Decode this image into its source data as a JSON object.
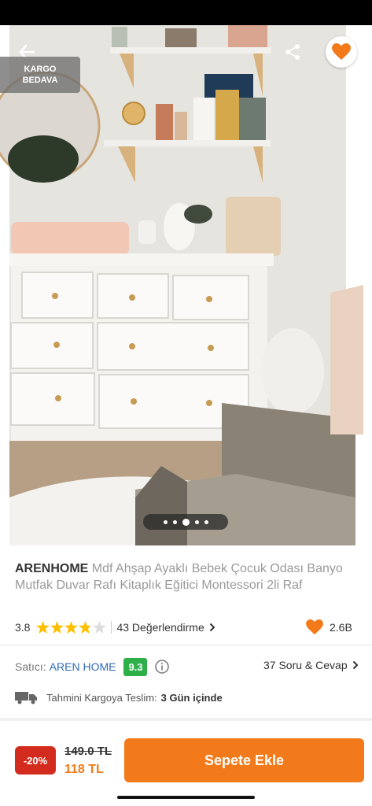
{
  "product": {
    "brand": "ARENHOME",
    "name": "Mdf Ahşap Ayaklı Bebek Çocuk Odası Banyo Mutfak Duvar Rafı Kitaplık Eğitici Montessori 2li Raf"
  },
  "image": {
    "badge_line1": "KARGO",
    "badge_line2": "BEDAVA",
    "carousel_total": 5,
    "carousel_active": 3
  },
  "rating": {
    "score": "3.8",
    "stars": 3.8,
    "reviews": "43 Değerlendirme",
    "likes": "2.6B"
  },
  "seller": {
    "label": "Satıcı:",
    "name": "AREN HOME",
    "score": "9.3",
    "qa": "37 Soru & Cevap"
  },
  "delivery": {
    "label": "Tahmini Kargoya Teslim:",
    "days": "3 Gün içinde"
  },
  "pricing": {
    "discount": "-20%",
    "old_price": "149.0 TL",
    "new_price": "118 TL",
    "cart_button": "Sepete Ekle"
  },
  "icons": {
    "back": "back-arrow-icon",
    "share": "share-icon",
    "favorite": "heart-icon",
    "info": "info-icon",
    "truck": "truck-icon",
    "chevron": "chevron-right-icon"
  },
  "colors": {
    "accent": "#f27a1a",
    "discount": "#d32b1e",
    "seller_score": "#2db04a",
    "link": "#2f6bb8"
  }
}
